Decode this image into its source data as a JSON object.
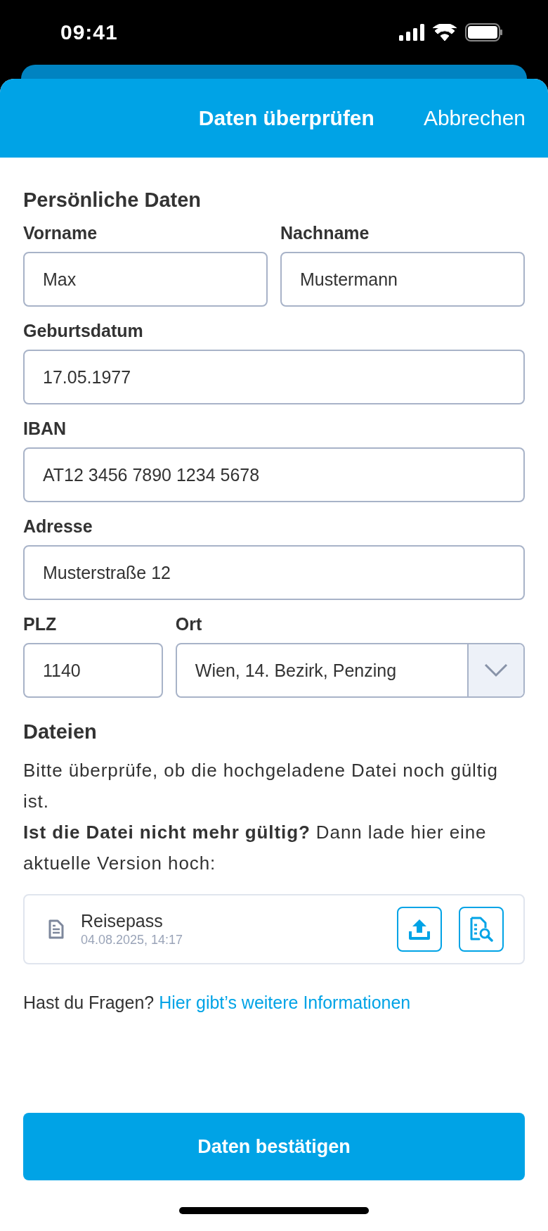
{
  "status_bar": {
    "time": "09:41"
  },
  "header": {
    "title": "Daten überprüfen",
    "cancel": "Abbrechen"
  },
  "personal": {
    "title": "Persönliche Daten",
    "rows": [
      [
        {
          "label": "Vorname",
          "value": "Max",
          "kind": "text"
        },
        {
          "label": "Nachname",
          "value": "Mustermann",
          "kind": "text"
        }
      ],
      [
        {
          "label": "Geburtsdatum",
          "value": "17.05.1977",
          "kind": "text"
        }
      ],
      [
        {
          "label": "IBAN",
          "value": "AT12 3456 7890 1234 5678",
          "kind": "text"
        }
      ],
      [
        {
          "label": "Adresse",
          "value": "Musterstraße 12",
          "kind": "text"
        }
      ],
      [
        {
          "label": "PLZ",
          "value": "1140",
          "kind": "text"
        },
        {
          "label": "Ort",
          "value": "Wien, 14. Bezirk, Penzing",
          "kind": "select"
        }
      ]
    ]
  },
  "files": {
    "title": "Dateien",
    "hint": "Bitte überprüfe, ob die hochgeladene Datei noch gültig ist.",
    "note": "**Ist die Datei nicht mehr gültig?** Dann lade hier eine aktuelle Version hoch:",
    "items": [
      {
        "name": "Reisepass",
        "date": "04.08.2025, 14:17"
      }
    ]
  },
  "help": {
    "text": "Hast du Fragen?",
    "link": "Hier gibt’s weitere Informationen"
  },
  "confirm_button": "Daten bestätigen"
}
